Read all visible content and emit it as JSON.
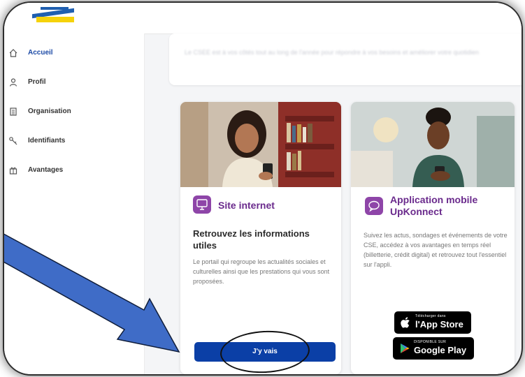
{
  "sidebar": {
    "items": [
      {
        "label": "Accueil",
        "icon": "home-icon",
        "active": true
      },
      {
        "label": "Profil",
        "icon": "user-icon",
        "active": false
      },
      {
        "label": "Organisation",
        "icon": "building-icon",
        "active": false
      },
      {
        "label": "Identifiants",
        "icon": "key-icon",
        "active": false
      },
      {
        "label": "Avantages",
        "icon": "gift-icon",
        "active": false
      }
    ]
  },
  "top_card": {
    "text": "Le CSEE est à vos côtés tout au long de l'année pour répondre à vos besoins et améliorer votre quotidien"
  },
  "cards": [
    {
      "title": "Site internet",
      "icon": "monitor-icon",
      "subtitle": "Retrouvez les informations utiles",
      "description": "Le portail qui regroupe les actualités sociales et culturelles ainsi que les prestations qui vous sont proposées.",
      "button": "J'y vais"
    },
    {
      "title": "Application mobile UpKonnect",
      "icon": "chat-icon",
      "description": "Suivez les actus, sondages et événements de votre CSE, accédez à vos avantages en temps réel (billetterie, crédit digital) et retrouvez tout l'essentiel sur l'appli.",
      "app_store": {
        "small": "Télécharger dans",
        "big": "l'App Store"
      },
      "google_play": {
        "small": "DISPONIBLE SUR",
        "big": "Google Play"
      }
    }
  ],
  "colors": {
    "primary": "#0b3fa6",
    "accent": "#8e45a8",
    "title": "#6a2a8c",
    "annotation_arrow": "#3f6cc7"
  }
}
